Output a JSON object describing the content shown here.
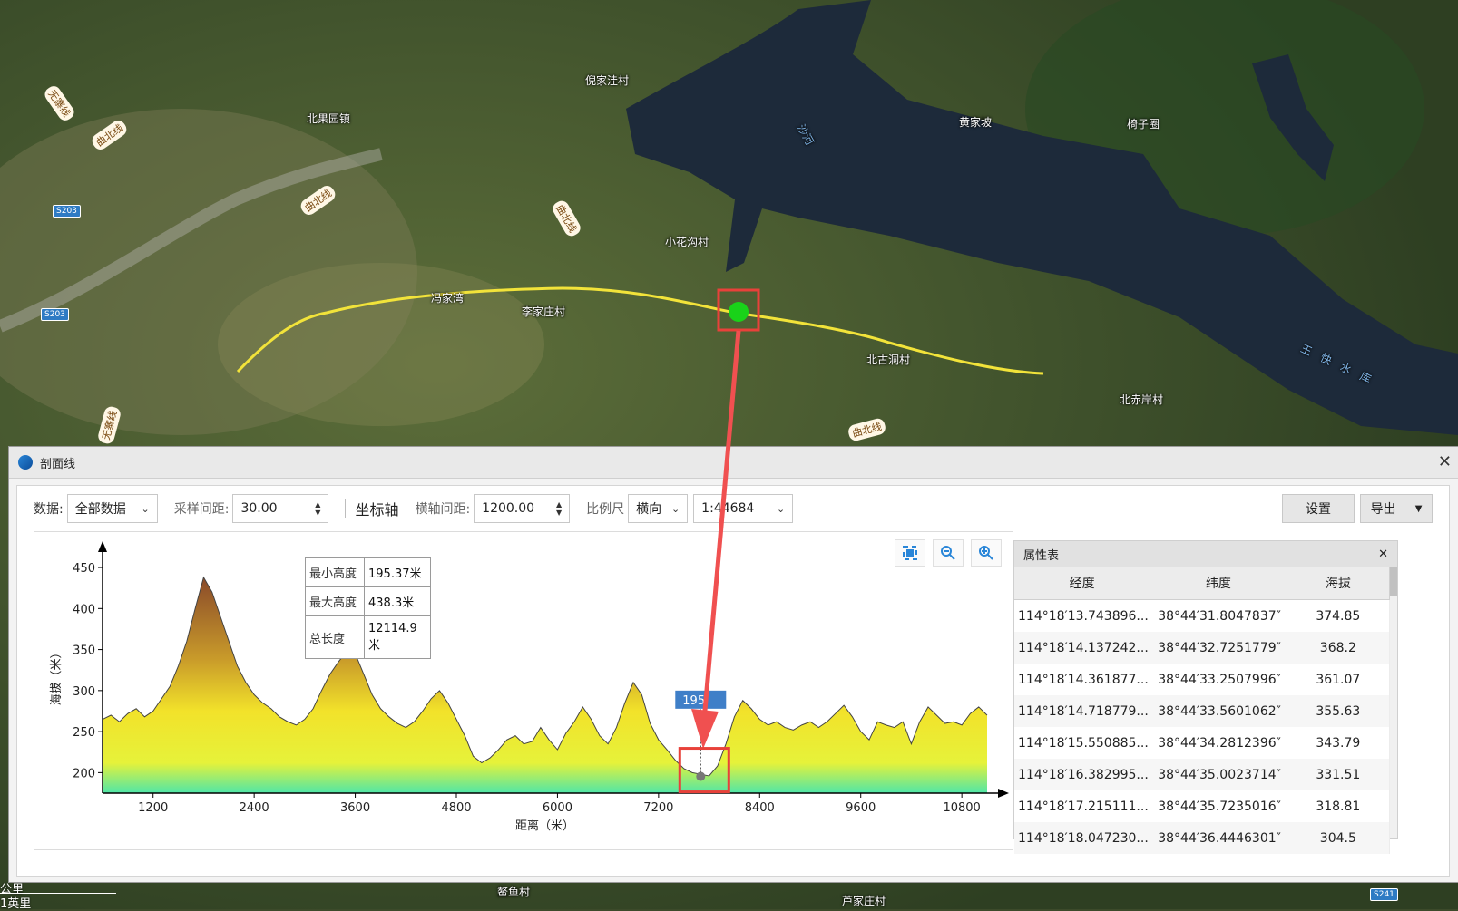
{
  "map": {
    "labels": [
      "倪家洼村",
      "北果园镇",
      "黄家坡",
      "椅子圈",
      "小花沟村",
      "冯家湾",
      "李家庄村",
      "北古洞村",
      "北赤岸村",
      "鳌鱼村",
      "芦家庄村",
      "沙河",
      "王快水库"
    ],
    "road_labels": [
      "曲北线",
      "曲北线",
      "曲北线",
      "曲北线",
      "无寨线",
      "无寨线"
    ],
    "road_badges": [
      "S203",
      "S203",
      "S241"
    ],
    "scale_metric": "公里",
    "scale_imperial": "1英里"
  },
  "panel": {
    "title": "剖面线",
    "close_label": "✕"
  },
  "toolbar": {
    "data_label": "数据:",
    "data_value": "全部数据",
    "sample_label": "采样间距:",
    "sample_value": "30.00",
    "axis_label": "坐标轴",
    "haxis_label": "横轴间距:",
    "haxis_value": "1200.00",
    "scale_label": "比例尺",
    "scale_dir": "横向",
    "scale_value": "1:44684",
    "settings_label": "设置",
    "export_label": "导出"
  },
  "stats": {
    "min_label": "最小高度",
    "min_value": "195.37米",
    "max_label": "最大高度",
    "max_value": "438.3米",
    "len_label": "总长度",
    "len_value": "12114.9米"
  },
  "marker": {
    "label": "195",
    "x": 7700,
    "y": 195.37
  },
  "chart_data": {
    "type": "area",
    "xlabel": "距离（米）",
    "ylabel": "海拔（米）",
    "xlim": [
      600,
      11100
    ],
    "ylim": [
      175,
      460
    ],
    "x_ticks": [
      1200,
      2400,
      3600,
      4800,
      6000,
      7200,
      8400,
      9600,
      10800
    ],
    "y_ticks": [
      200,
      250,
      300,
      350,
      400,
      450
    ],
    "x": [
      600,
      700,
      800,
      900,
      1000,
      1100,
      1200,
      1300,
      1400,
      1500,
      1600,
      1700,
      1800,
      1900,
      2000,
      2100,
      2200,
      2300,
      2400,
      2500,
      2600,
      2700,
      2800,
      2900,
      3000,
      3100,
      3200,
      3300,
      3400,
      3500,
      3600,
      3700,
      3800,
      3900,
      4000,
      4100,
      4200,
      4300,
      4400,
      4500,
      4600,
      4700,
      4800,
      4900,
      5000,
      5100,
      5200,
      5300,
      5400,
      5500,
      5600,
      5700,
      5800,
      5900,
      6000,
      6100,
      6200,
      6300,
      6400,
      6500,
      6600,
      6700,
      6800,
      6900,
      7000,
      7100,
      7200,
      7300,
      7400,
      7500,
      7600,
      7700,
      7800,
      7900,
      8000,
      8100,
      8200,
      8300,
      8400,
      8500,
      8600,
      8700,
      8800,
      8900,
      9000,
      9100,
      9200,
      9300,
      9400,
      9500,
      9600,
      9700,
      9800,
      9900,
      10000,
      10100,
      10200,
      10300,
      10400,
      10500,
      10600,
      10700,
      10800,
      10900,
      11000,
      11100
    ],
    "values": [
      265,
      270,
      262,
      272,
      278,
      268,
      275,
      290,
      305,
      330,
      360,
      400,
      438,
      420,
      390,
      360,
      330,
      310,
      295,
      285,
      278,
      268,
      262,
      258,
      265,
      278,
      300,
      320,
      335,
      348,
      345,
      320,
      295,
      278,
      268,
      260,
      255,
      262,
      275,
      290,
      300,
      285,
      265,
      245,
      220,
      212,
      218,
      228,
      240,
      245,
      235,
      238,
      255,
      240,
      228,
      248,
      262,
      280,
      265,
      245,
      235,
      255,
      285,
      310,
      295,
      260,
      240,
      228,
      215,
      205,
      200,
      198,
      196,
      208,
      235,
      268,
      288,
      278,
      265,
      258,
      262,
      255,
      252,
      258,
      262,
      255,
      262,
      272,
      282,
      268,
      250,
      240,
      262,
      258,
      255,
      262,
      235,
      262,
      280,
      270,
      260,
      262,
      258,
      272,
      280,
      270
    ]
  },
  "attr_table": {
    "title": "属性表",
    "close_label": "✕",
    "headers": [
      "经度",
      "纬度",
      "海拔"
    ],
    "rows": [
      [
        "114°18′13.743896...",
        "38°44′31.8047837″",
        "374.85"
      ],
      [
        "114°18′14.137242...",
        "38°44′32.7251779″",
        "368.2"
      ],
      [
        "114°18′14.361877...",
        "38°44′33.2507996″",
        "361.07"
      ],
      [
        "114°18′14.718779...",
        "38°44′33.5601062″",
        "355.63"
      ],
      [
        "114°18′15.550885...",
        "38°44′34.2812396″",
        "343.79"
      ],
      [
        "114°18′16.382995...",
        "38°44′35.0023714″",
        "331.51"
      ],
      [
        "114°18′17.215111...",
        "38°44′35.7235016″",
        "318.81"
      ],
      [
        "114°18′18.047230...",
        "38°44′36.4446301″",
        "304.5"
      ]
    ]
  }
}
